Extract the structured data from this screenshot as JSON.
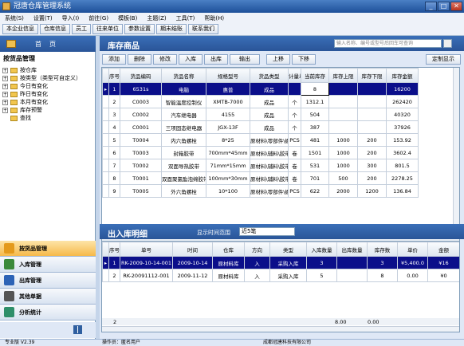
{
  "window": {
    "title": "冠唐仓库管理系统"
  },
  "menu": [
    "系统(S)",
    "设置(T)",
    "导入(I)",
    "前往(G)",
    "模板(B)",
    "主题(Z)",
    "工具(T)",
    "帮助(H)"
  ],
  "toolbar": [
    "本企业信息",
    "仓库信息",
    "员工",
    "往来单位",
    "参数设置",
    "期末结账",
    "联系我们"
  ],
  "sidebar": {
    "home": "首页",
    "nav_title": "按货品管理",
    "tree": [
      {
        "label": "按仓库",
        "exp": true
      },
      {
        "label": "按类型（类型可自定义）",
        "exp": true
      },
      {
        "label": "今日有变化",
        "exp": true
      },
      {
        "label": "昨日有变化",
        "exp": true
      },
      {
        "label": "本月有变化",
        "exp": true
      },
      {
        "label": "库存预警",
        "exp": true
      },
      {
        "label": "查找",
        "exp": false
      }
    ],
    "modules": [
      {
        "label": "按货品管理",
        "active": true,
        "color": "#e49a1c"
      },
      {
        "label": "入库管理",
        "active": false,
        "color": "#3b8a3b"
      },
      {
        "label": "出库管理",
        "active": false,
        "color": "#2d63b6"
      },
      {
        "label": "其他单据",
        "active": false,
        "color": "#555555"
      },
      {
        "label": "分析统计",
        "active": false,
        "color": "#2f8f6a"
      }
    ]
  },
  "inventory": {
    "title": "库存商品",
    "search_placeholder": "输入名称、编号或型号后回车可查询",
    "actions": [
      "添加",
      "删除",
      "修改",
      "入库",
      "出库",
      "输出",
      "上移",
      "下移"
    ],
    "display_button": "定制显示",
    "columns": [
      "序号",
      "货品编码",
      "货品名称",
      "规格型号",
      "货品类型",
      "计量单位",
      "当前库存",
      "库存上限",
      "库存下限",
      "库存金额"
    ],
    "rows": [
      [
        "1",
        "6531s",
        "电脑",
        "惠普",
        "成品",
        "",
        "8",
        "",
        "",
        "16200"
      ],
      [
        "2",
        "C0003",
        "智能温度控制仪",
        "XMTB-7000",
        "成品",
        "个",
        "1312.1",
        "",
        "",
        "262420"
      ],
      [
        "3",
        "C0002",
        "汽车继电器",
        "4155",
        "成品",
        "个",
        "504",
        "",
        "",
        "40320"
      ],
      [
        "4",
        "C0001",
        "三项固态继电器",
        "JGX-13F",
        "成品",
        "个",
        "387",
        "",
        "",
        "37926"
      ],
      [
        "5",
        "T0004",
        "内六角螺栓",
        "8*25",
        "原材料\\零部件\\螺栓",
        "PCS",
        "481",
        "1000",
        "200",
        "153.92"
      ],
      [
        "6",
        "T0003",
        "封箱胶带",
        "700mm*45mm",
        "原材料\\辅料\\胶带",
        "卷",
        "1501",
        "1000",
        "200",
        "3602.4"
      ],
      [
        "7",
        "T0002",
        "双面导热胶带",
        "71mm*15mm",
        "原材料\\辅料\\胶带",
        "卷",
        "531",
        "1000",
        "300",
        "801.5"
      ],
      [
        "8",
        "T0001",
        "双面聚氯酯泡绵胶带",
        "100mm*30mm",
        "原材料\\辅料\\胶带",
        "卷",
        "701",
        "500",
        "200",
        "2278.25"
      ],
      [
        "9",
        "T0005",
        "外六角螺栓",
        "10*100",
        "原材料\\零部件\\螺栓",
        "PCS",
        "622",
        "2000",
        "1200",
        "136.84"
      ]
    ]
  },
  "inout": {
    "title": "出入库明细",
    "range_label": "显示时间范围",
    "range_value": "近5笔",
    "columns": [
      "序号",
      "单号",
      "时间",
      "仓库",
      "方向",
      "类型",
      "入库数量",
      "出库数量",
      "库存数",
      "单价",
      "金额"
    ],
    "rows": [
      [
        "1",
        "RK-2009-10-14-001",
        "2009-10-14",
        "原材料库",
        "入",
        "采购入库",
        "3",
        "",
        "3",
        "¥5,400.0",
        "¥16"
      ],
      [
        "2",
        "RK-20091112-001",
        "2009-11-12",
        "原材料库",
        "入",
        "采购入库",
        "5",
        "",
        "8",
        "0.00",
        "¥0"
      ]
    ],
    "totals": {
      "count": "2",
      "in_qty": "8.00",
      "out_qty": "0.00"
    }
  },
  "status": {
    "edition": "专业版 V2.39",
    "operator": "操作员：匿名用户",
    "company": "成都冠唐科技有限公司"
  }
}
